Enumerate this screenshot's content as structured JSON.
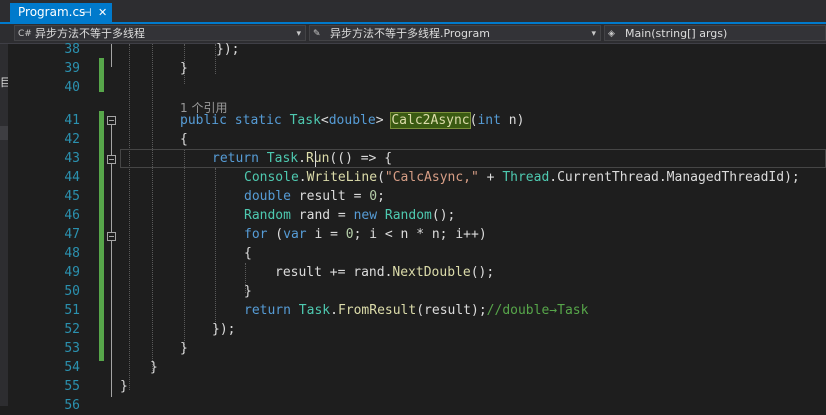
{
  "tab": {
    "title": "Program.cs",
    "pin_glyph": "⊣",
    "close_glyph": "✕"
  },
  "navbar": {
    "project": {
      "icon": "C#",
      "label": "异步方法不等于多线程"
    },
    "class": {
      "icon": "✎",
      "label": "异步方法不等于多线程.Program"
    },
    "member": {
      "icon": "◈",
      "label": "Main(string[] args)"
    },
    "dropdown_arrow": "▾"
  },
  "left_strip": {
    "glyph": "目"
  },
  "editor": {
    "line_numbers": [
      "38",
      "39",
      "40",
      "",
      "41",
      "42",
      "43",
      "44",
      "45",
      "46",
      "47",
      "48",
      "49",
      "50",
      "51",
      "52",
      "53",
      "54",
      "55",
      "56"
    ],
    "code_lens": "1 个引用",
    "lines": [
      {
        "parts": [
          {
            "t": "});",
            "c": ""
          }
        ]
      },
      {
        "parts": [
          {
            "t": "}",
            "c": ""
          }
        ]
      },
      {
        "parts": []
      },
      {
        "parts": [
          {
            "t": "1 个引用",
            "c": "lens"
          }
        ]
      },
      {
        "parts": [
          {
            "t": "public",
            "c": "kw"
          },
          {
            "t": " ",
            "c": ""
          },
          {
            "t": "static",
            "c": "kw"
          },
          {
            "t": " ",
            "c": ""
          },
          {
            "t": "Task",
            "c": "ty"
          },
          {
            "t": "<",
            "c": ""
          },
          {
            "t": "double",
            "c": "kw"
          },
          {
            "t": "> ",
            "c": ""
          },
          {
            "t": "Calc2Async",
            "c": "hl"
          },
          {
            "t": "(",
            "c": ""
          },
          {
            "t": "int",
            "c": "kw"
          },
          {
            "t": " n)",
            "c": ""
          }
        ]
      },
      {
        "parts": [
          {
            "t": "{",
            "c": ""
          }
        ]
      },
      {
        "parts": [
          {
            "t": "return",
            "c": "kw"
          },
          {
            "t": " ",
            "c": ""
          },
          {
            "t": "Task",
            "c": "ty"
          },
          {
            "t": ".",
            "c": ""
          },
          {
            "t": "Run",
            "c": "me"
          },
          {
            "t": "(() => {",
            "c": ""
          }
        ]
      },
      {
        "parts": [
          {
            "t": "Console",
            "c": "ty"
          },
          {
            "t": ".",
            "c": ""
          },
          {
            "t": "WriteLine",
            "c": "me"
          },
          {
            "t": "(",
            "c": ""
          },
          {
            "t": "\"CalcAsync,\"",
            "c": "st"
          },
          {
            "t": " + ",
            "c": ""
          },
          {
            "t": "Thread",
            "c": "ty"
          },
          {
            "t": ".CurrentThread.ManagedThreadId);",
            "c": ""
          }
        ]
      },
      {
        "parts": [
          {
            "t": "double",
            "c": "kw"
          },
          {
            "t": " result = ",
            "c": ""
          },
          {
            "t": "0",
            "c": "nu"
          },
          {
            "t": ";",
            "c": ""
          }
        ]
      },
      {
        "parts": [
          {
            "t": "Random",
            "c": "ty"
          },
          {
            "t": " rand = ",
            "c": ""
          },
          {
            "t": "new",
            "c": "kw"
          },
          {
            "t": " ",
            "c": ""
          },
          {
            "t": "Random",
            "c": "ty"
          },
          {
            "t": "();",
            "c": ""
          }
        ]
      },
      {
        "parts": [
          {
            "t": "for",
            "c": "kw"
          },
          {
            "t": " (",
            "c": ""
          },
          {
            "t": "var",
            "c": "kw"
          },
          {
            "t": " i = ",
            "c": ""
          },
          {
            "t": "0",
            "c": "nu"
          },
          {
            "t": "; i < n * n; i++)",
            "c": ""
          }
        ]
      },
      {
        "parts": [
          {
            "t": "{",
            "c": ""
          }
        ]
      },
      {
        "parts": [
          {
            "t": "result += rand.",
            "c": ""
          },
          {
            "t": "NextDouble",
            "c": "me"
          },
          {
            "t": "();",
            "c": ""
          }
        ]
      },
      {
        "parts": [
          {
            "t": "}",
            "c": ""
          }
        ]
      },
      {
        "parts": [
          {
            "t": "return",
            "c": "kw"
          },
          {
            "t": " ",
            "c": ""
          },
          {
            "t": "Task",
            "c": "ty"
          },
          {
            "t": ".",
            "c": ""
          },
          {
            "t": "FromResult",
            "c": "me"
          },
          {
            "t": "(result);",
            "c": ""
          },
          {
            "t": "//double→Task",
            "c": "cm"
          }
        ]
      },
      {
        "parts": [
          {
            "t": "});",
            "c": ""
          }
        ]
      },
      {
        "parts": [
          {
            "t": "}",
            "c": ""
          }
        ]
      },
      {
        "parts": [
          {
            "t": "}",
            "c": ""
          }
        ]
      },
      {
        "parts": [
          {
            "t": "}",
            "c": ""
          }
        ]
      },
      {
        "parts": []
      }
    ]
  },
  "colors": {
    "accent": "#007acc",
    "background": "#1e1e1e",
    "line_number": "#2b91af",
    "keyword": "#569cd6",
    "type": "#4ec9b0",
    "method": "#dcdcaa",
    "string": "#d69d85",
    "comment": "#57a64a"
  }
}
